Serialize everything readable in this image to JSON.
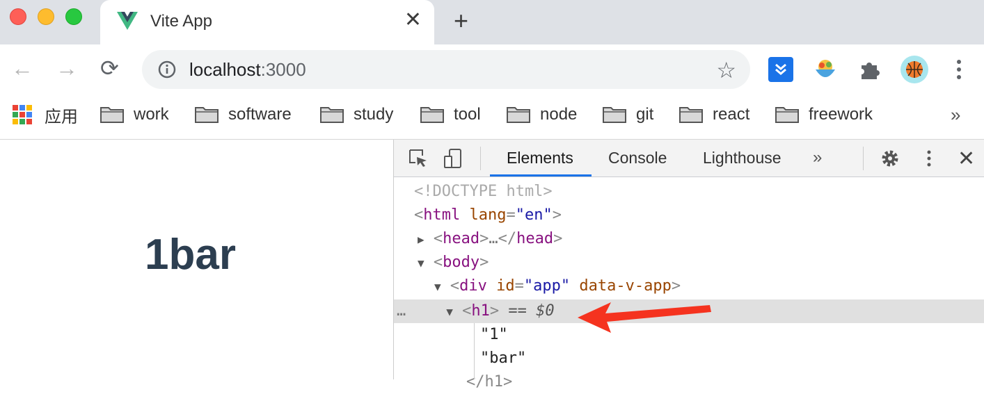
{
  "tab": {
    "title": "Vite App",
    "close": "✕",
    "new_tab": "+"
  },
  "toolbar": {
    "back": "←",
    "forward": "→",
    "reload": "⟳",
    "url_host": "localhost",
    "url_port": ":3000",
    "star": "☆"
  },
  "bookmarks": {
    "apps_label": "应用",
    "items": [
      "work",
      "software",
      "study",
      "tool",
      "node",
      "git",
      "react",
      "freework"
    ],
    "overflow": "»"
  },
  "page": {
    "heading": "1bar"
  },
  "devtools": {
    "tabs": [
      "Elements",
      "Console",
      "Lighthouse"
    ],
    "more_tabs": "»",
    "close": "✕",
    "dom": {
      "doctype": "<!DOCTYPE html>",
      "html_tag": "html",
      "html_attr": "lang",
      "html_attr_value": "\"en\"",
      "head_tag": "head",
      "head_ellipsis": "…",
      "body_tag": "body",
      "div_tag": "div",
      "div_attr": "id",
      "div_attr_value": "\"app\"",
      "div_attr2": "data-v-app",
      "h1_tag": "h1",
      "selected_marker": "== $0",
      "gutter_dots": "…",
      "text1": "\"1\"",
      "text2": "\"bar\"",
      "closing": "</h1>"
    }
  },
  "colors": {
    "accent": "#1a73e8",
    "heading": "#2c3e50",
    "annotation_arrow": "#f5331f"
  }
}
